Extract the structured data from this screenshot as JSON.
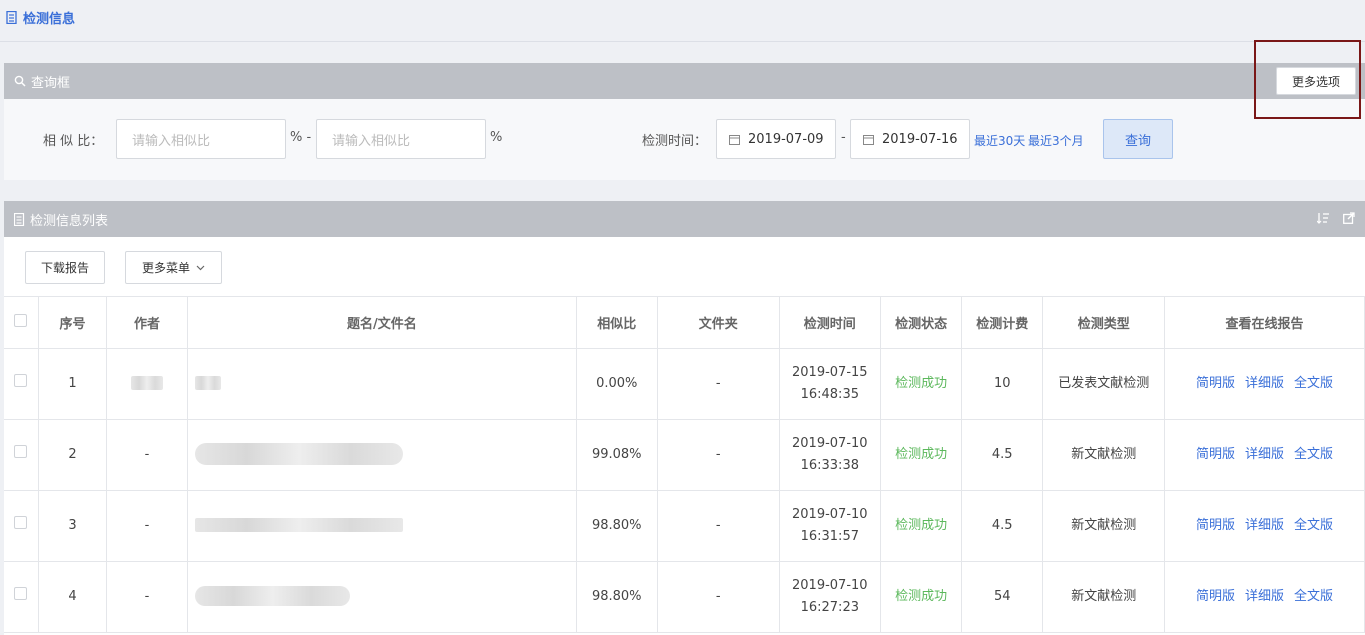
{
  "page": {
    "title": "检测信息"
  },
  "query": {
    "header": "查询框",
    "more_options": "更多选项",
    "similarity_label": "相 似 比：",
    "similarity_min_placeholder": "请输入相似比",
    "similarity_max_placeholder": "请输入相似比",
    "pct_sep": "% -",
    "pct_end": "%",
    "time_label": "检测时间：",
    "date_start": "2019-07-09",
    "date_sep": "-",
    "date_end": "2019-07-16",
    "quick_30": "最近30天",
    "quick_3m": "最近3个月",
    "query_btn": "查询"
  },
  "list": {
    "header": "检测信息列表",
    "download_btn": "下载报告",
    "more_menu_btn": "更多菜单",
    "columns": [
      "序号",
      "作者",
      "题名/文件名",
      "相似比",
      "文件夹",
      "检测时间",
      "检测状态",
      "检测计费",
      "检测类型",
      "查看在线报告"
    ],
    "rows": [
      {
        "no": "1",
        "author": "",
        "title": "",
        "similarity": "0.00%",
        "folder": "-",
        "date": "2019-07-15",
        "time": "16:48:35",
        "status": "检测成功",
        "fee": "10",
        "type": "已发表文献检测"
      },
      {
        "no": "2",
        "author": "-",
        "title": "",
        "similarity": "99.08%",
        "folder": "-",
        "date": "2019-07-10",
        "time": "16:33:38",
        "status": "检测成功",
        "fee": "4.5",
        "type": "新文献检测"
      },
      {
        "no": "3",
        "author": "-",
        "title": "",
        "similarity": "98.80%",
        "folder": "-",
        "date": "2019-07-10",
        "time": "16:31:57",
        "status": "检测成功",
        "fee": "4.5",
        "type": "新文献检测"
      },
      {
        "no": "4",
        "author": "-",
        "title": "",
        "similarity": "98.80%",
        "folder": "-",
        "date": "2019-07-10",
        "time": "16:27:23",
        "status": "检测成功",
        "fee": "54",
        "type": "新文献检测"
      }
    ],
    "report_links": [
      "简明版",
      "详细版",
      "全文版"
    ]
  }
}
